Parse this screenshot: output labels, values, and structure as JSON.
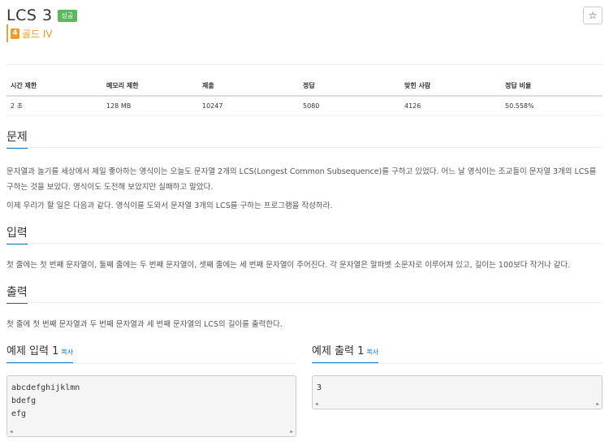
{
  "problem": {
    "title": "LCS 3",
    "status_badge": "성공",
    "tier_level": "4",
    "tier_label": "골드 IV",
    "star": "☆"
  },
  "stats": {
    "headers": [
      "시간 제한",
      "메모리 제한",
      "제출",
      "정답",
      "맞힌 사람",
      "정답 비율"
    ],
    "values": [
      "2 초",
      "128 MB",
      "10247",
      "5080",
      "4126",
      "50.558%"
    ]
  },
  "sections": {
    "problem_title": "문제",
    "problem_p1": "문자열과 놀기를 세상에서 제일 좋아하는 영식이는 오늘도 문자열 2개의 LCS(Longest Common Subsequence)를 구하고 있었다. 어느 날 영식이는 조교들이 문자열 3개의 LCS를 구하는 것을 보았다. 영식이도 도전해 보았지만 실패하고 말았다.",
    "problem_p2": "이제 우리가 할 일은 다음과 같다. 영식이를 도와서 문자열 3개의 LCS를 구하는 프로그램을 작성하라.",
    "input_title": "입력",
    "input_p": "첫 줄에는 첫 번째 문자열이, 둘째 줄에는 두 번째 문자열이, 셋째 줄에는 세 번째 문자열이 주어진다. 각 문자열은 알파벳 소문자로 이루어져 있고, 길이는 100보다 작거나 같다.",
    "output_title": "출력",
    "output_p": "첫 줄에 첫 번째 문자열과 두 번째 문자열과 세 번째 문자열의 LCS의 길이를 출력한다."
  },
  "examples": {
    "input_title": "예제 입력 1",
    "input_copy": "복사",
    "input_lines": [
      "abcdefghijklmn",
      "bdefg",
      "efg"
    ],
    "output_title": "예제 출력 1",
    "output_copy": "복사",
    "output_lines": [
      "3"
    ],
    "scroll_left": "◀",
    "scroll_right": "▶"
  }
}
